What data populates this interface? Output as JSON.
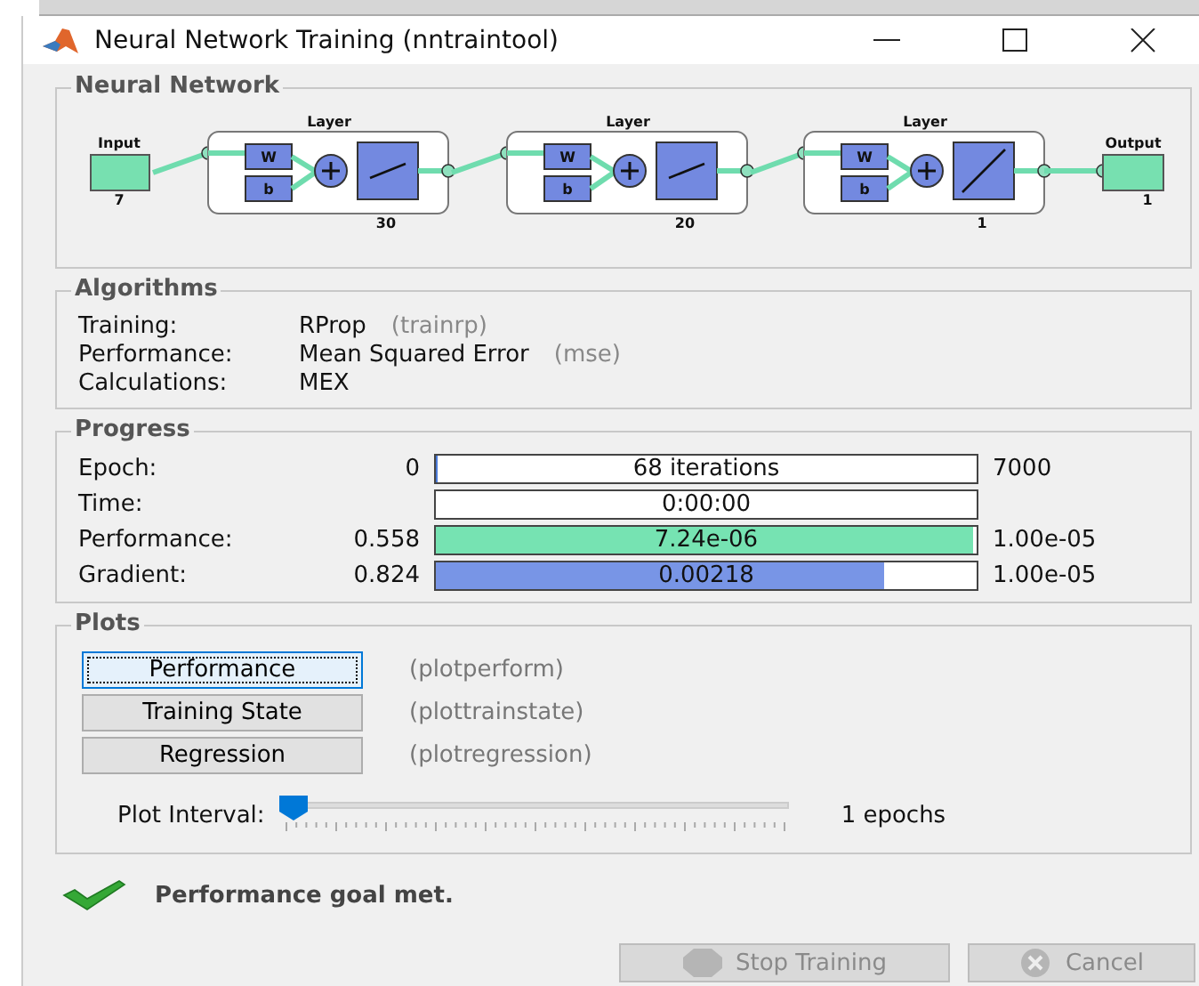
{
  "window": {
    "title": "Neural Network Training (nntraintool)"
  },
  "network": {
    "title": "Neural Network",
    "input": {
      "label": "Input",
      "size": "7"
    },
    "output": {
      "label": "Output",
      "size": "1"
    },
    "layers": [
      {
        "label": "Layer",
        "weight": "W",
        "bias": "b",
        "size": "30",
        "kind": "sigmoid"
      },
      {
        "label": "Layer",
        "weight": "W",
        "bias": "b",
        "size": "20",
        "kind": "sigmoid"
      },
      {
        "label": "Layer",
        "weight": "W",
        "bias": "b",
        "size": "1",
        "kind": "linear"
      }
    ]
  },
  "algorithms": {
    "title": "Algorithms",
    "rows": [
      {
        "label": "Training:",
        "value": "RProp",
        "code": "(trainrp)"
      },
      {
        "label": "Performance:",
        "value": "Mean Squared Error",
        "code": "(mse)"
      },
      {
        "label": "Calculations:",
        "value": "MEX"
      }
    ]
  },
  "progress": {
    "title": "Progress",
    "rows": [
      {
        "label": "Epoch:",
        "start": "0",
        "kind": "plain",
        "level": 0.004,
        "reading": "68 iterations",
        "end": "7000"
      },
      {
        "label": "Time:",
        "kind": "plain",
        "level": 0,
        "reading": "0:00:00"
      },
      {
        "label": "Performance:",
        "start": "0.558",
        "kind": "performance",
        "level": 0.995,
        "reading": "7.24e-06",
        "end": "1.00e-05"
      },
      {
        "label": "Gradient:",
        "start": "0.824",
        "kind": "gradient",
        "level": 0.83,
        "reading": "0.00218",
        "end": "1.00e-05"
      }
    ]
  },
  "plots": {
    "title": "Plots",
    "buttons": [
      {
        "label": "Performance",
        "function": "(plotperform)",
        "focused": true
      },
      {
        "label": "Training State",
        "function": "(plottrainstate)",
        "focused": false
      },
      {
        "label": "Regression",
        "function": "(plotregression)",
        "focused": false
      }
    ],
    "interval": {
      "label": "Plot Interval:",
      "level": 0,
      "reading": "1 epochs"
    }
  },
  "status": {
    "message": "Performance goal met."
  },
  "buttons": [
    {
      "label": "Stop Training",
      "kind": "stop",
      "disabled": true
    },
    {
      "label": "Cancel",
      "kind": "cancel",
      "disabled": true
    }
  ]
}
